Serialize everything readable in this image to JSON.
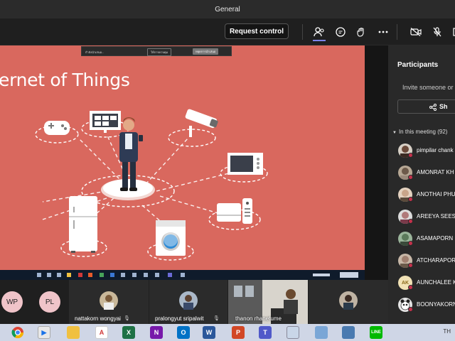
{
  "window": {
    "title": "General"
  },
  "toolbar": {
    "request_control_label": "Request control"
  },
  "slide": {
    "title": "ernet of Things",
    "share_bar_text": "กำลังนำเสนอ...",
    "share_bar_btn1": "ให้การควบคุม",
    "share_bar_btn2": "หยุดการนำเสนอ"
  },
  "participants": {
    "title": "Participants",
    "invite_placeholder": "Invite someone or d",
    "share_label": "Sh",
    "in_meeting_label": "In this meeting (92)",
    "list": [
      {
        "name": "pimpilar chank",
        "avatar_color": "#6b4a3a"
      },
      {
        "name": "AMONRAT KH",
        "avatar_color": "#8c7b6a"
      },
      {
        "name": "ANOTHAI PHU",
        "avatar_color": "#c9a58a"
      },
      {
        "name": "AREEYA SEESC",
        "avatar_color": "#b07a7a"
      },
      {
        "name": "ASAMAPORN",
        "avatar_color": "#5b7a5b"
      },
      {
        "name": "ATCHARAPOR",
        "avatar_color": "#a08070"
      },
      {
        "name": "AUNCHALEE K",
        "avatar_color": "#f1e2b5",
        "initials": "AK"
      },
      {
        "name": "BOONYAKORN",
        "avatar_color": "#e6e6e6"
      }
    ]
  },
  "video_strip": {
    "tile1_initials": "WP",
    "tile2_initials": "PL",
    "tile3_name": "nattakorn wongyai",
    "tile4_name": "pralongyut sripalwit",
    "tile5_name": "thanon rhanetume"
  },
  "taskbar": {
    "tray_text": "TH",
    "icons": [
      "chrome",
      "media-player",
      "paint",
      "acrobat",
      "excel",
      "onenote",
      "outlook",
      "word",
      "powerpoint",
      "teams",
      "control-panel",
      "photos",
      "network",
      "line"
    ]
  }
}
